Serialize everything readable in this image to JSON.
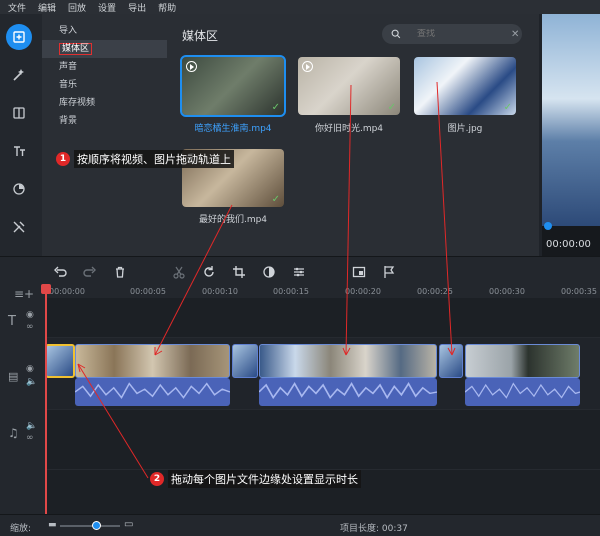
{
  "menu": [
    "文件",
    "编辑",
    "回放",
    "设置",
    "导出",
    "帮助"
  ],
  "toolbar_icons": [
    "import-icon",
    "magic-wand-icon",
    "transition-icon",
    "text-icon",
    "timer-icon",
    "tools-icon"
  ],
  "categories": [
    "导入",
    "媒体区",
    "声音",
    "音乐",
    "库存视频",
    "背景"
  ],
  "active_category": "媒体区",
  "media": {
    "title": "媒体区",
    "search_placeholder": "查找",
    "items": [
      {
        "label": "暗恋橘生淮南.mp4",
        "type": "video",
        "selected": true
      },
      {
        "label": "你好旧时光.mp4",
        "type": "video",
        "selected": false
      },
      {
        "label": "图片.jpg",
        "type": "image",
        "selected": false
      },
      {
        "label": "最好的我们.mp4",
        "type": "video",
        "selected": false
      }
    ]
  },
  "preview": {
    "time": "00:00:00"
  },
  "ruler": [
    "00:00:00",
    "00:00:05",
    "00:00:10",
    "00:00:15",
    "00:00:20",
    "00:00:25",
    "00:00:30",
    "00:00:35"
  ],
  "annotations": {
    "a1": {
      "num": "1",
      "text": "按顺序将视频、图片拖动轨道上"
    },
    "a2": {
      "num": "2",
      "text": "拖动每个图片文件边缘处设置显示时长"
    }
  },
  "status": {
    "zoom_label": "缩放:",
    "project_length_label": "项目长度:",
    "project_length": "00:37"
  },
  "colors": {
    "accent": "#1e8ef0",
    "annotation": "#e02828",
    "playhead": "#e04848"
  }
}
